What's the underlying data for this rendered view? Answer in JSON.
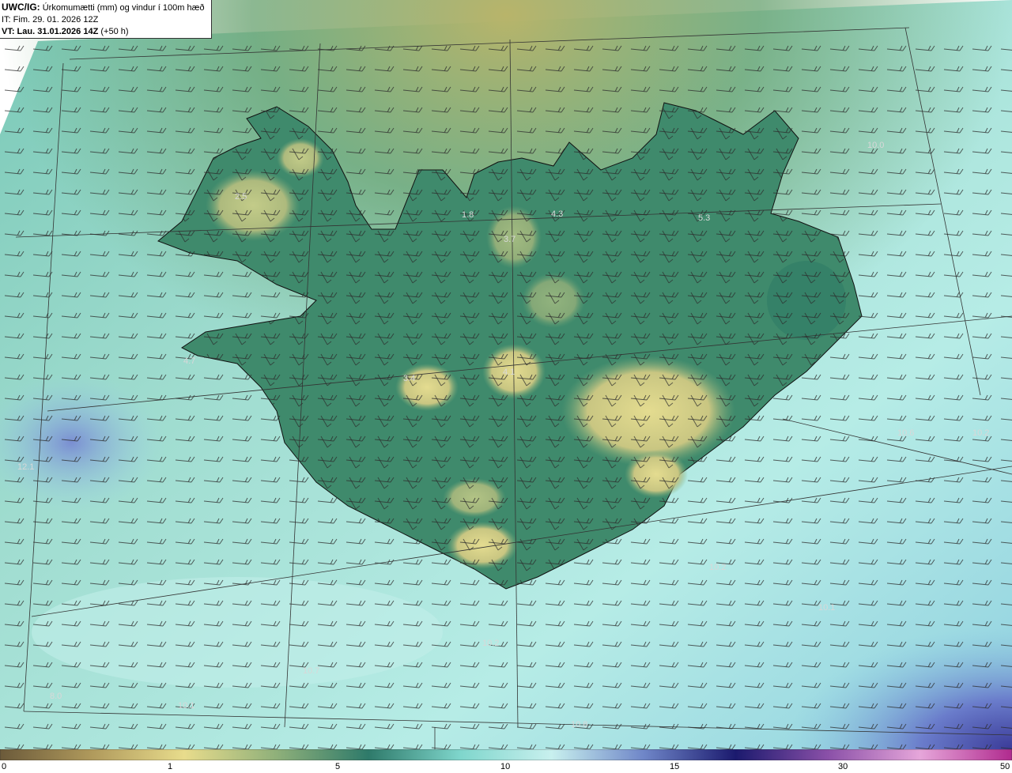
{
  "header": {
    "model": "UWC/IG:",
    "title": "Úrkomumætti (mm) og vindur í 100m hæð",
    "init_time": "IT: Fim. 29. 01. 2026 12Z",
    "valid_prefix": "VT: Lau. 31.01.2026 14Z",
    "valid_suffix": "(+50 h)"
  },
  "map_labels": [
    "10.0",
    "2.5",
    "1.8",
    "3.7",
    "4.3",
    "5.3",
    "4.7",
    "3.4",
    "4.1",
    "10.6",
    "10.2",
    "12.1",
    "10.2",
    "10.1",
    "10.2",
    "10.7",
    "8.0",
    "10.1",
    "10.8"
  ],
  "legend": {
    "ticks": [
      "0",
      "1",
      "5",
      "10",
      "15",
      "30",
      "50"
    ],
    "colors": [
      "#6b5a3a",
      "#b09a5c",
      "#e8dc8c",
      "#8fb07a",
      "#2e7a6a",
      "#7fd6cc",
      "#c8f0ee",
      "#6f86c8",
      "#1b1a6e",
      "#8a50a8",
      "#e6a6da",
      "#b02a8e"
    ]
  },
  "colors": {
    "land_low": "#2f7c66",
    "land_high": "#d7d38a",
    "sea": "#a9e4dc",
    "heavy": "#5a6fbf"
  }
}
